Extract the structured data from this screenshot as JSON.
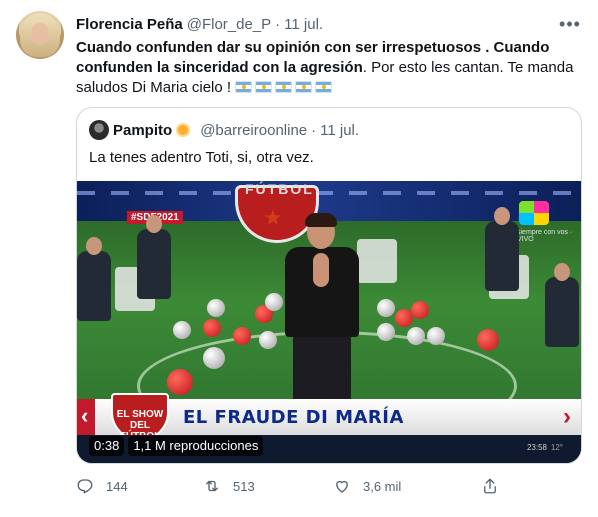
{
  "author": {
    "name": "Florencia Peña",
    "handle": "@Flor_de_P",
    "separator": "·",
    "date": "11 jul."
  },
  "tweet": {
    "text_bold": "Cuando confunden dar su opinión con ser irrespetuosos . Cuando confunden la sinceridad con la agresión",
    "text_regular": ". Por esto les cantan. Te manda saludos Di Maria cielo !",
    "flag_count": 5
  },
  "quoted": {
    "name": "Pampito",
    "handle": "@barreiroonline",
    "separator": "·",
    "date": "11 jul.",
    "text": "La tenes adentro Toti, si, otra vez."
  },
  "video": {
    "duration": "0:38",
    "views": "1,1 M reproducciones",
    "headline": "EL FRAUDE DI MARÍA",
    "show_tag": "#SDF2021",
    "show_logo": "EL SHOW DEL FÚTBOL",
    "top_logo": "FÚTBOL",
    "channel_text": "siempre con vos · VIVO",
    "clock": "23:58",
    "clock_extra": "12°"
  },
  "actions": {
    "replies": "144",
    "retweets": "513",
    "likes": "3,6 mil"
  },
  "colors": {
    "text_primary": "#0f1419",
    "text_secondary": "#536471",
    "border": "#cfd9de",
    "headline_blue": "#0d2a8a",
    "brand_red": "#c2192d"
  }
}
